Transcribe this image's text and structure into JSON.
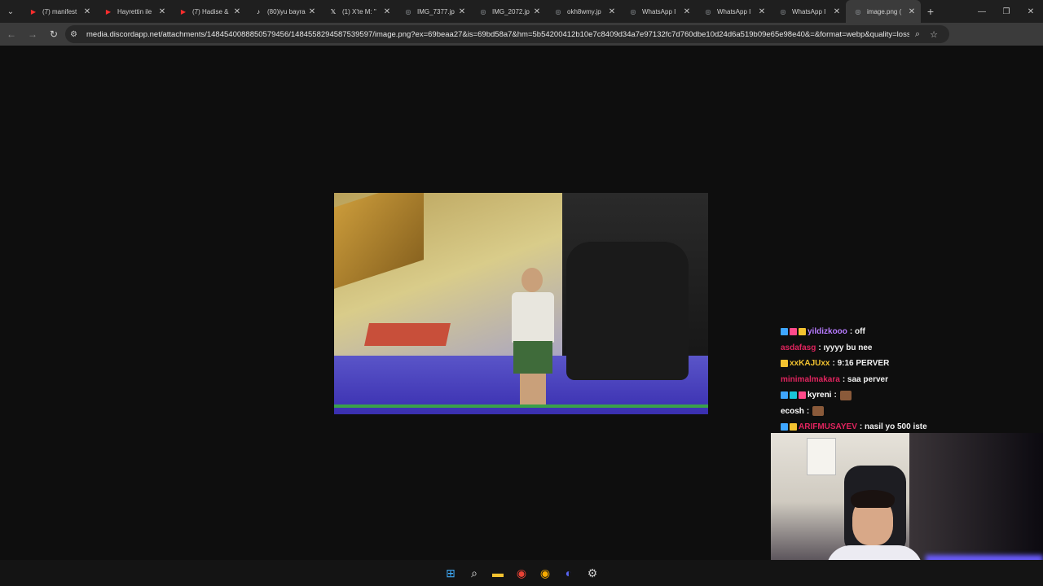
{
  "browser": {
    "tabs": [
      {
        "title": "(7) manifest",
        "icon": "youtube-icon",
        "icon_color": "#ff2d2d",
        "active": false
      },
      {
        "title": "Hayrettin ile",
        "icon": "youtube-icon",
        "icon_color": "#ff2d2d",
        "active": false
      },
      {
        "title": "(7) Hadise &",
        "icon": "youtube-icon",
        "icon_color": "#ff2d2d",
        "active": false
      },
      {
        "title": "(80)iyu bayra",
        "icon": "tiktok-icon",
        "icon_color": "#ffffff",
        "active": false
      },
      {
        "title": "(1) X'te M: \"",
        "icon": "x-icon",
        "icon_color": "#ffffff",
        "active": false
      },
      {
        "title": "IMG_7377.jp",
        "icon": "globe-icon",
        "icon_color": "#9aa0a6",
        "active": false
      },
      {
        "title": "IMG_2072.jp",
        "icon": "globe-icon",
        "icon_color": "#9aa0a6",
        "active": false
      },
      {
        "title": "okh8wmy.jp",
        "icon": "globe-icon",
        "icon_color": "#9aa0a6",
        "active": false
      },
      {
        "title": "WhatsApp I",
        "icon": "globe-icon",
        "icon_color": "#9aa0a6",
        "active": false
      },
      {
        "title": "WhatsApp I",
        "icon": "globe-icon",
        "icon_color": "#9aa0a6",
        "active": false
      },
      {
        "title": "WhatsApp I",
        "icon": "globe-icon",
        "icon_color": "#9aa0a6",
        "active": false
      },
      {
        "title": "image.png (",
        "icon": "globe-icon",
        "icon_color": "#9aa0a6",
        "active": true
      }
    ],
    "url": "media.discordapp.net/attachments/1484540088850579456/1484558294587539597/image.png?ex=69beaa27&is=69bd58a7&hm=5b54200412b10e7c8409d34a7e97132fc7d760dbe10d24d6a519b09e65e98e40&=&format=webp&quality=lossle..."
  },
  "chat": [
    {
      "user": "yildizkooo",
      "user_color": "#b77bff",
      "text": ": off",
      "badges": [
        "#3ea6ff",
        "#ff4a8a",
        "#f2c230"
      ]
    },
    {
      "user": "asdafasg",
      "user_color": "#e0245e",
      "text": ": ıyyyy bu nee",
      "badges": []
    },
    {
      "user": "xxKAJUxx",
      "user_color": "#f2c230",
      "text": ": 9:16 PERVER",
      "badges": [
        "#f2c230"
      ]
    },
    {
      "user": "minimalmakara",
      "user_color": "#e0245e",
      "text": ": saa perver",
      "badges": []
    },
    {
      "user": "kyreni",
      "user_color": "#ffffff",
      "text": ":",
      "badges": [
        "#3ea6ff",
        "#19c3d8",
        "#ff4a8a"
      ],
      "emote": true
    },
    {
      "user": "ecosh",
      "user_color": "#ffffff",
      "text": ":",
      "badges": [],
      "emote": true
    },
    {
      "user": "ARIFMUSAYEV",
      "user_color": "#e0245e",
      "text": ": nasil yo 500 iste",
      "badges": [
        "#3ea6ff",
        "#f2c230"
      ]
    }
  ],
  "taskbar": {
    "icons": [
      {
        "name": "windows-start-icon",
        "glyph": "⊞",
        "color": "#3fa9f5"
      },
      {
        "name": "search-icon",
        "glyph": "⌕",
        "color": "#e8e8e8"
      },
      {
        "name": "file-explorer-icon",
        "glyph": "▬",
        "color": "#f2c230"
      },
      {
        "name": "chrome-icon",
        "glyph": "◉",
        "color": "#e94235"
      },
      {
        "name": "chrome-icon",
        "glyph": "◉",
        "color": "#f9ab00"
      },
      {
        "name": "discord-icon",
        "glyph": "◐",
        "color": "#5865f2"
      },
      {
        "name": "settings-icon",
        "glyph": "⚙",
        "color": "#d0d0d0"
      }
    ]
  }
}
